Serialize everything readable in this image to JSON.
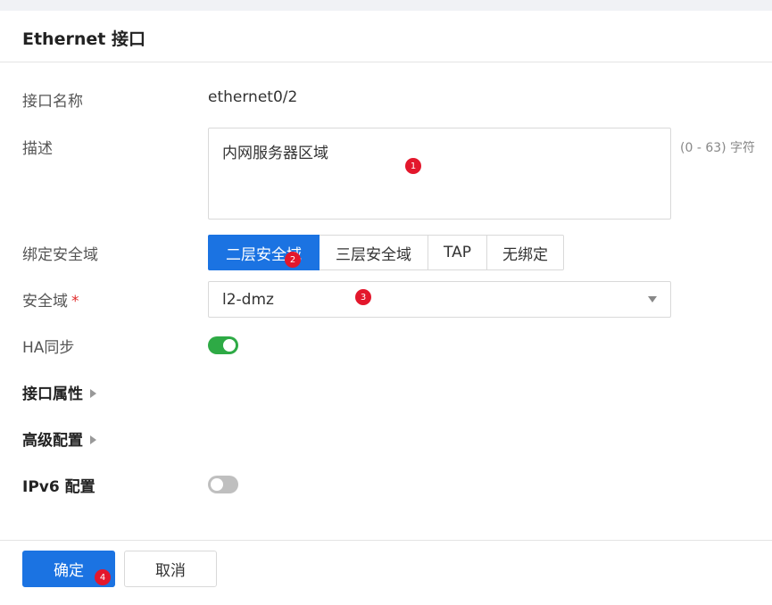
{
  "dialog": {
    "title": "Ethernet 接口"
  },
  "form": {
    "name_label": "接口名称",
    "name_value": "ethernet0/2",
    "desc_label": "描述",
    "desc_value": "内网服务器区域",
    "desc_hint": "(0 - 63) 字符",
    "bind_label": "绑定安全域",
    "bind_options": [
      "二层安全域",
      "三层安全域",
      "TAP",
      "无绑定"
    ],
    "bind_selected": "二层安全域",
    "zone_label": "安全域",
    "zone_required": "*",
    "zone_value": "l2-dmz",
    "ha_label": "HA同步",
    "ha_enabled": true,
    "iface_props_label": "接口属性",
    "advanced_label": "高级配置",
    "ipv6_label": "IPv6 配置",
    "ipv6_enabled": false
  },
  "footer": {
    "confirm_label": "确定",
    "cancel_label": "取消"
  },
  "markers": [
    "1",
    "2",
    "3",
    "4"
  ],
  "colors": {
    "primary": "#1b73e2",
    "toggle_on": "#2eaa45",
    "toggle_off": "#bfbfbf",
    "marker": "#e3172c"
  }
}
